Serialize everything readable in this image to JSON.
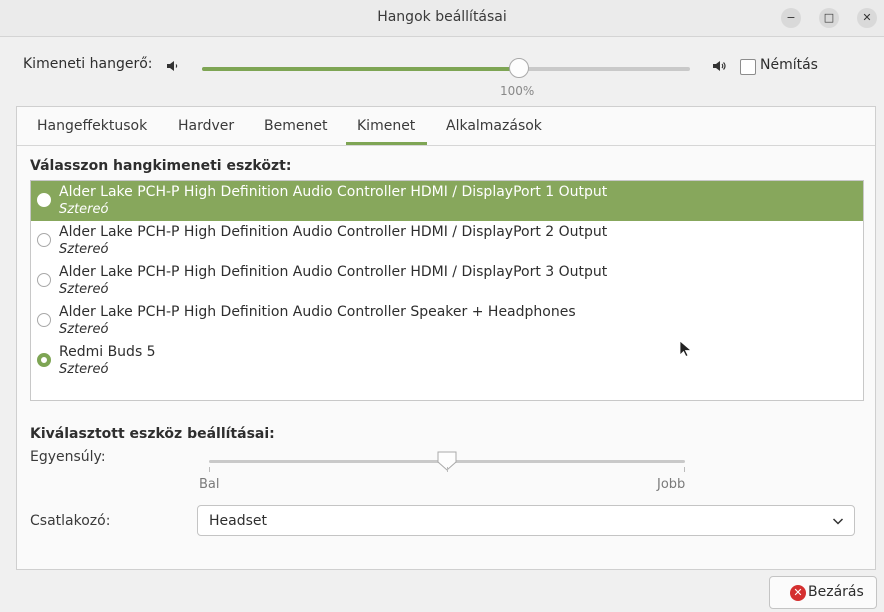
{
  "window": {
    "title": "Hangok beállításai",
    "minimize_glyph": "−",
    "maximize_glyph": "□",
    "close_glyph": "✕"
  },
  "output_volume": {
    "label": "Kimeneti hangerő:",
    "value_text": "100%",
    "level_fraction": 0.65,
    "mute_label": "Némítás",
    "mute_checked": false,
    "low_icon": "speaker-low-icon",
    "high_icon": "speaker-high-icon"
  },
  "tabs": [
    {
      "label": "Hangeffektusok",
      "active": false
    },
    {
      "label": "Hardver",
      "active": false
    },
    {
      "label": "Bemenet",
      "active": false
    },
    {
      "label": "Kimenet",
      "active": true
    },
    {
      "label": "Alkalmazások",
      "active": false
    }
  ],
  "output": {
    "choose_title": "Válasszon hangkimeneti eszközt:",
    "devices": [
      {
        "name": "Alder Lake PCH-P High Definition Audio Controller HDMI / DisplayPort 1 Output",
        "profile": "Sztereó",
        "highlighted": true,
        "checked": false
      },
      {
        "name": "Alder Lake PCH-P High Definition Audio Controller HDMI / DisplayPort 2 Output",
        "profile": "Sztereó",
        "highlighted": false,
        "checked": false
      },
      {
        "name": "Alder Lake PCH-P High Definition Audio Controller HDMI / DisplayPort 3 Output",
        "profile": "Sztereó",
        "highlighted": false,
        "checked": false
      },
      {
        "name": "Alder Lake PCH-P High Definition Audio Controller Speaker + Headphones",
        "profile": "Sztereó",
        "highlighted": false,
        "checked": false
      },
      {
        "name": "Redmi Buds 5",
        "profile": "Sztereó",
        "highlighted": false,
        "checked": true
      }
    ],
    "settings_title": "Kiválasztott eszköz beállításai:",
    "balance": {
      "label": "Egyensúly:",
      "left_label": "Bal",
      "right_label": "Jobb",
      "position_fraction": 0.5
    },
    "connector": {
      "label": "Csatlakozó:",
      "value": "Headset"
    }
  },
  "footer": {
    "close_label": "Bezárás"
  },
  "colors": {
    "accent": "#7ea554",
    "selection": "#87a75c",
    "close_red": "#d42f2f"
  }
}
